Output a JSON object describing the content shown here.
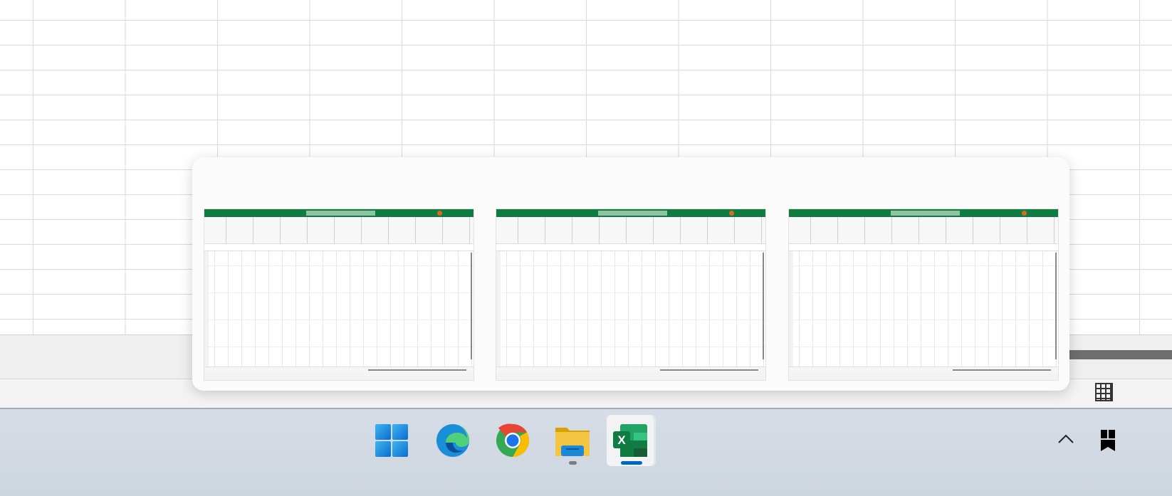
{
  "taskbar": {
    "items": [
      {
        "name": "start",
        "icon": "windows-logo-icon"
      },
      {
        "name": "edge",
        "icon": "edge-icon"
      },
      {
        "name": "chrome",
        "icon": "chrome-icon"
      },
      {
        "name": "file-explorer",
        "icon": "folder-icon",
        "running": true
      },
      {
        "name": "excel",
        "icon": "excel-icon",
        "active": true,
        "label": "X"
      }
    ],
    "tray": {
      "overflow_icon": "chevron-up-icon"
    }
  },
  "preview": {
    "app": "Excel",
    "window_count": 3
  },
  "colors": {
    "excel_green": "#107c41",
    "accent": "#0067c0"
  }
}
